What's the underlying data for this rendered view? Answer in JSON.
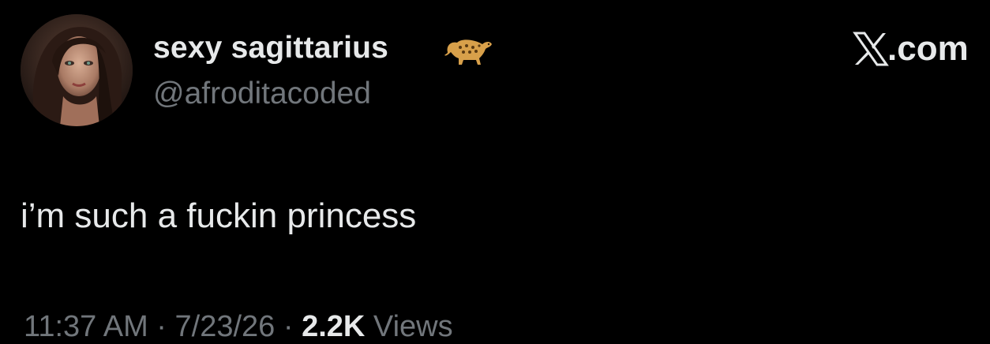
{
  "author": {
    "display_name": "sexy sagittarius",
    "name_emoji": "leopard-icon",
    "handle": "@afroditacoded",
    "avatar": "avatar"
  },
  "brand": {
    "logo": "x-logo-icon",
    "text": ".com"
  },
  "tweet": {
    "text": "i’m such a fuckin princess"
  },
  "meta": {
    "time": "11:37 AM",
    "separator_1": " · ",
    "date": "7/23/26",
    "separator_2": " · ",
    "views_count": "2.2K",
    "views_label": " Views"
  },
  "colors": {
    "background": "#000000",
    "primary_text": "#e7e9ea",
    "secondary_text": "#71767b"
  }
}
